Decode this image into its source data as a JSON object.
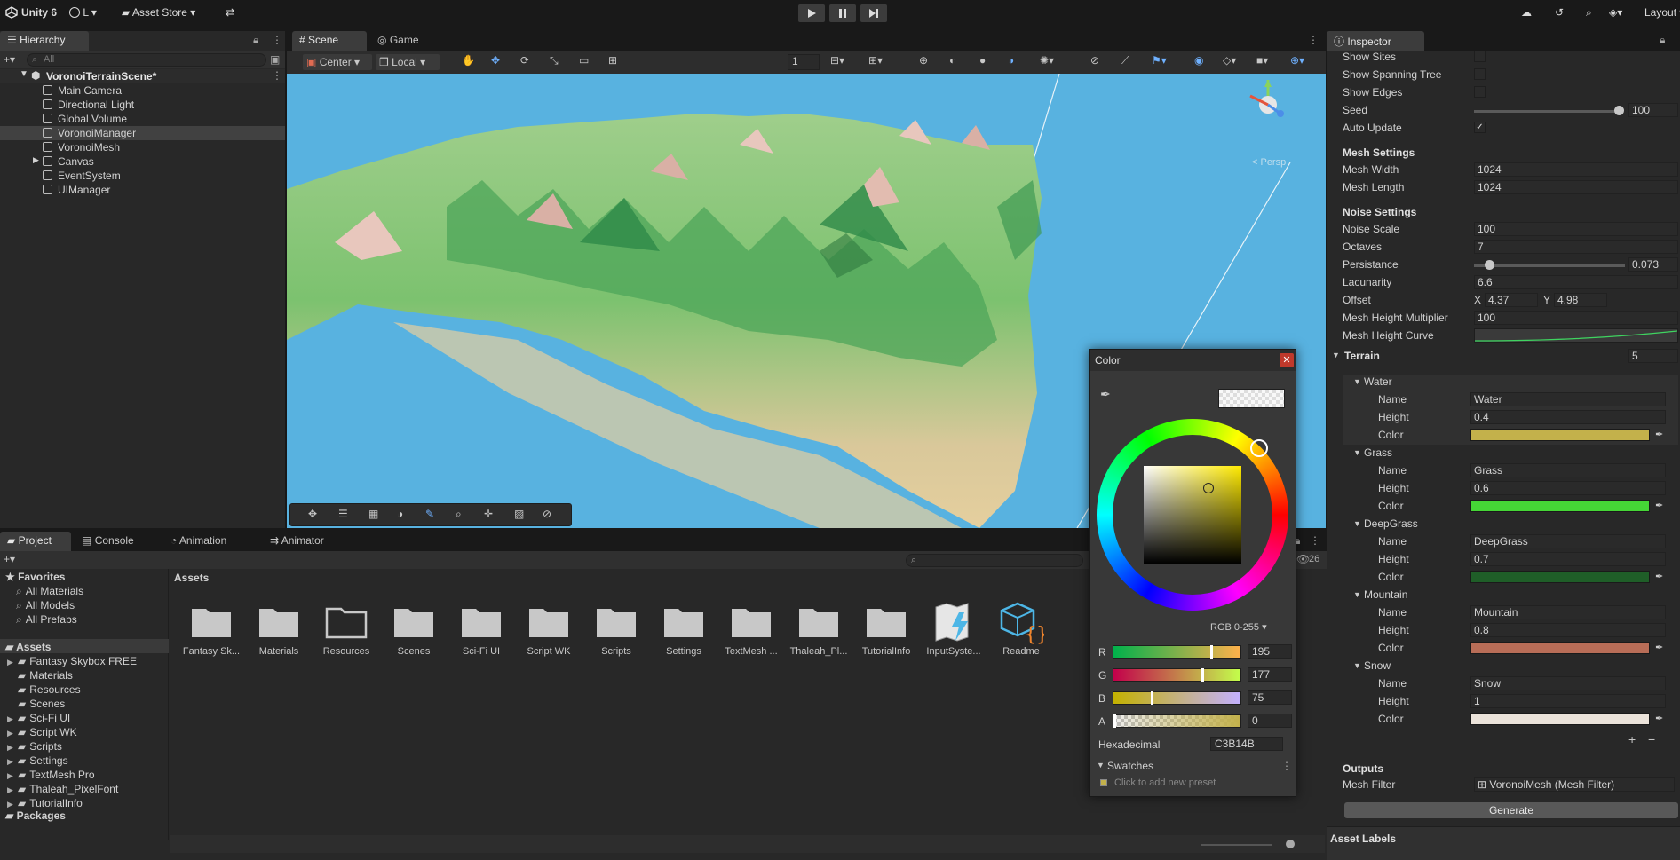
{
  "topbar": {
    "app_name": "Unity 6",
    "account_label": "L",
    "asset_store_label": "Asset Store",
    "layout_label": "Layout"
  },
  "hierarchy": {
    "tab_label": "Hierarchy",
    "search_placeholder": "All",
    "scene_name": "VoronoiTerrainScene*",
    "items": [
      {
        "label": "Main Camera"
      },
      {
        "label": "Directional Light"
      },
      {
        "label": "Global Volume"
      },
      {
        "label": "VoronoiManager"
      },
      {
        "label": "VoronoiMesh"
      },
      {
        "label": "Canvas"
      },
      {
        "label": "EventSystem"
      },
      {
        "label": "UIManager"
      }
    ]
  },
  "scene": {
    "tabs": [
      {
        "label": "Scene"
      },
      {
        "label": "Game"
      }
    ],
    "pivot_label": "Center",
    "space_label": "Local",
    "grid_value": "1",
    "persp_label": "< Persp"
  },
  "inspector": {
    "tab_label": "Inspector",
    "show_sites_label": "Show Sites",
    "show_spanning_tree_label": "Show Spanning Tree",
    "show_edges_label": "Show Edges",
    "seed_label": "Seed",
    "seed_value": "100",
    "seed_fraction": 1.0,
    "auto_update_label": "Auto Update",
    "mesh_settings_header": "Mesh Settings",
    "mesh_width_label": "Mesh Width",
    "mesh_width_value": "1024",
    "mesh_length_label": "Mesh Length",
    "mesh_length_value": "1024",
    "noise_settings_header": "Noise Settings",
    "noise_scale_label": "Noise Scale",
    "noise_scale_value": "100",
    "octaves_label": "Octaves",
    "octaves_value": "7",
    "persistance_label": "Persistance",
    "persistance_value": "0.073",
    "persistance_fraction": 0.073,
    "lacunarity_label": "Lacunarity",
    "lacunarity_value": "6.6",
    "offset_label": "Offset",
    "offset_x_label": "X",
    "offset_x_value": "4.37",
    "offset_y_label": "Y",
    "offset_y_value": "4.98",
    "height_multiplier_label": "Mesh Height Multiplier",
    "height_multiplier_value": "100",
    "height_curve_label": "Mesh Height Curve",
    "terrain_label": "Terrain",
    "terrain_count": "5",
    "name_label": "Name",
    "height_label": "Height",
    "color_label": "Color",
    "terrain_layers": [
      {
        "title": "Water",
        "name": "Water",
        "height": "0.4",
        "color": "#c3b14b"
      },
      {
        "title": "Grass",
        "name": "Grass",
        "height": "0.6",
        "color": "#45d536"
      },
      {
        "title": "DeepGrass",
        "name": "DeepGrass",
        "height": "0.7",
        "color": "#1f5e28"
      },
      {
        "title": "Mountain",
        "name": "Mountain",
        "height": "0.8",
        "color": "#b86d57"
      },
      {
        "title": "Snow",
        "name": "Snow",
        "height": "1",
        "color": "#ebe3da"
      }
    ],
    "outputs_header": "Outputs",
    "mesh_filter_label": "Mesh Filter",
    "mesh_filter_value": "VoronoiMesh (Mesh Filter)",
    "generate_label": "Generate",
    "asset_labels_header": "Asset Labels"
  },
  "project": {
    "tabs": [
      {
        "label": "Project"
      },
      {
        "label": "Console"
      },
      {
        "label": "Animation"
      },
      {
        "label": "Animator"
      }
    ],
    "favorites_label": "Favorites",
    "favorites": [
      {
        "label": "All Materials"
      },
      {
        "label": "All Models"
      },
      {
        "label": "All Prefabs"
      }
    ],
    "assets_label": "Assets",
    "asset_tree": [
      {
        "label": "Fantasy Skybox FREE"
      },
      {
        "label": "Materials"
      },
      {
        "label": "Resources"
      },
      {
        "label": "Scenes"
      },
      {
        "label": "Sci-Fi UI"
      },
      {
        "label": "Script WK"
      },
      {
        "label": "Scripts"
      },
      {
        "label": "Settings"
      },
      {
        "label": "TextMesh Pro"
      },
      {
        "label": "Thaleah_PixelFont"
      },
      {
        "label": "TutorialInfo"
      }
    ],
    "packages_label": "Packages",
    "breadcrumb": "Assets",
    "count_badge": "26",
    "grid_items": [
      {
        "label": "Fantasy Sk..."
      },
      {
        "label": "Materials"
      },
      {
        "label": "Resources"
      },
      {
        "label": "Scenes"
      },
      {
        "label": "Sci-Fi UI"
      },
      {
        "label": "Script WK"
      },
      {
        "label": "Scripts"
      },
      {
        "label": "Settings"
      },
      {
        "label": "TextMesh ..."
      },
      {
        "label": "Thaleah_Pl..."
      },
      {
        "label": "TutorialInfo"
      },
      {
        "label": "InputSyste..."
      },
      {
        "label": "Readme"
      }
    ]
  },
  "color_picker": {
    "title": "Color",
    "mode_label": "RGB 0-255",
    "r_label": "R",
    "r_value": "195",
    "r_fraction": 0.765,
    "g_label": "G",
    "g_value": "177",
    "g_fraction": 0.694,
    "b_label": "B",
    "b_value": "75",
    "b_fraction": 0.294,
    "a_label": "A",
    "a_value": "0",
    "hex_label": "Hexadecimal",
    "hex_value": "C3B14B",
    "swatches_label": "Swatches",
    "add_preset_label": "Click to add new preset",
    "current_color": "#c3b14b"
  }
}
